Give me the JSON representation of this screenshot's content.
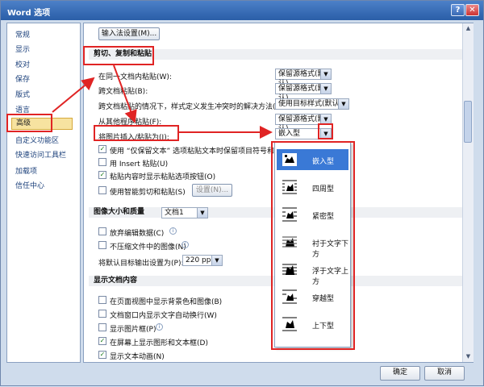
{
  "window": {
    "title": "Word 选项",
    "help_glyph": "?",
    "close_glyph": "✕"
  },
  "sidebar": {
    "items": [
      {
        "label": "常规"
      },
      {
        "label": "显示"
      },
      {
        "label": "校对"
      },
      {
        "label": "保存"
      },
      {
        "label": "版式"
      },
      {
        "label": "语言"
      },
      {
        "label": "高级",
        "active": true
      },
      {
        "label": "自定义功能区"
      },
      {
        "label": "快速访问工具栏"
      },
      {
        "label": "加载项"
      },
      {
        "label": "信任中心"
      }
    ]
  },
  "ime_button": "输入法设置(M)...",
  "section_paste": "剪切、复制和粘贴",
  "paste_rows": [
    {
      "label": "在同一文档内粘贴(W):",
      "value": "保留源格式(默认)"
    },
    {
      "label": "跨文档粘贴(B):",
      "value": "保留源格式(默认)"
    },
    {
      "label": "跨文档粘贴的情况下，样式定义发生冲突时的解决方法(E):",
      "value": "使用目标样式(默认)"
    },
    {
      "label": "从其他程序粘贴(F):",
      "value": "保留源格式(默认)"
    },
    {
      "label": "将图片插入/粘贴为(I):",
      "value": "嵌入型"
    }
  ],
  "paste_checks": [
    {
      "label": "使用 “仅保留文本” 选项粘贴文本时保留项目符号和编号",
      "checked": true
    },
    {
      "label": "用 Insert 粘贴(U)",
      "checked": false
    },
    {
      "label": "粘贴内容时显示粘贴选项按钮(O)",
      "checked": true
    },
    {
      "label": "使用智能剪切和粘贴(S)",
      "checked": false
    }
  ],
  "settings_button": "设置(N)...",
  "section_image": "图像大小和质量",
  "image_doc": "文档1",
  "image_checks": [
    {
      "label": "放弃编辑数据(C)",
      "checked": false
    },
    {
      "label": "不压缩文件中的图像(N)",
      "checked": false
    }
  ],
  "ppi_label": "将默认目标输出设置为(P):",
  "ppi_value": "220 ppi",
  "section_display": "显示文档内容",
  "display_checks": [
    {
      "label": "在页面视图中显示背景色和图像(B)",
      "checked": false
    },
    {
      "label": "文档窗口内显示文字自动换行(W)",
      "checked": false
    },
    {
      "label": "显示图片框(P)",
      "checked": false
    },
    {
      "label": "在屏幕上显示图形和文本框(D)",
      "checked": true
    },
    {
      "label": "显示文本动画(N)",
      "checked": true
    }
  ],
  "wrap_options": [
    {
      "label": "嵌入型",
      "icon": "inline-icon",
      "selected": true
    },
    {
      "label": "四周型",
      "icon": "square-wrap-icon"
    },
    {
      "label": "紧密型",
      "icon": "tight-wrap-icon"
    },
    {
      "label": "衬于文字下方",
      "icon": "behind-text-icon"
    },
    {
      "label": "浮于文字上方",
      "icon": "in-front-text-icon"
    },
    {
      "label": "穿越型",
      "icon": "through-wrap-icon"
    },
    {
      "label": "上下型",
      "icon": "top-bottom-wrap-icon"
    }
  ],
  "footer": {
    "ok": "确定",
    "cancel": "取消"
  },
  "colors": {
    "highlight": "#e02424",
    "selection": "#3a79d6"
  }
}
